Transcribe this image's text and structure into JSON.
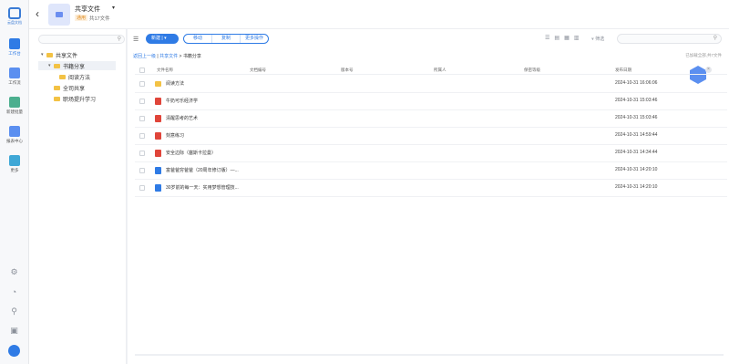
{
  "app": {
    "logo_text": "云盘文档"
  },
  "nav": [
    {
      "label": "工作台",
      "icon": "home-icon",
      "color": "#2f7be5"
    },
    {
      "label": "工作流",
      "icon": "workflow-icon",
      "color": "#5b8ff0"
    },
    {
      "label": "新建批量",
      "icon": "batch-icon",
      "color": "#4caf8f"
    },
    {
      "label": "报表中心",
      "icon": "report-icon",
      "color": "#5b8ff0"
    },
    {
      "label": "更多",
      "icon": "apps-icon",
      "color": "#3fa7d6"
    }
  ],
  "header": {
    "title": "共享文件",
    "tag": "通用",
    "count": "共17文件"
  },
  "tree": {
    "nodes": [
      {
        "label": "共享文件",
        "level": 0,
        "expanded": true
      },
      {
        "label": "书籍分享",
        "level": 1,
        "expanded": true,
        "selected": true
      },
      {
        "label": "阅读方法",
        "level": 2
      },
      {
        "label": "全司共享",
        "level": 1
      },
      {
        "label": "职场提升学习",
        "level": 1
      }
    ]
  },
  "toolbar": {
    "new_label": "新建 | ▾",
    "move_label": "移动",
    "copy_label": "复制",
    "more_label": "更多操作",
    "filter_label": "筛选"
  },
  "breadcrumb": {
    "back": "返回上一级",
    "root": "共享文件",
    "current": "书籍分享"
  },
  "loaded_text": "已加载全部,共7文件",
  "table": {
    "columns": [
      "文件名称",
      "文档编号",
      "版本号",
      "所属人",
      "保密等级",
      "发布日期"
    ],
    "rows": [
      {
        "name": "阅读方法",
        "type": "folder",
        "date": "2024-10-31 16:06:06"
      },
      {
        "name": "牛奶可乐经济学",
        "type": "pdf",
        "date": "2024-10-31 15:03:46"
      },
      {
        "name": "清醒思考的艺术",
        "type": "pdf",
        "date": "2024-10-31 15:03:46"
      },
      {
        "name": "刻意练习",
        "type": "pdf",
        "date": "2024-10-31 14:59:44"
      },
      {
        "name": "安全边际（塞斯卡拉曼）",
        "type": "pdf",
        "date": "2024-10-31 14:34:44"
      },
      {
        "name": "富爸爸穷爸爸（20周年修订版）—...",
        "type": "doc",
        "date": "2024-10-31 14:20:10"
      },
      {
        "name": "30岁前的每一天：实用梦想管理技...",
        "type": "doc",
        "date": "2024-10-31 14:20:10"
      }
    ]
  }
}
